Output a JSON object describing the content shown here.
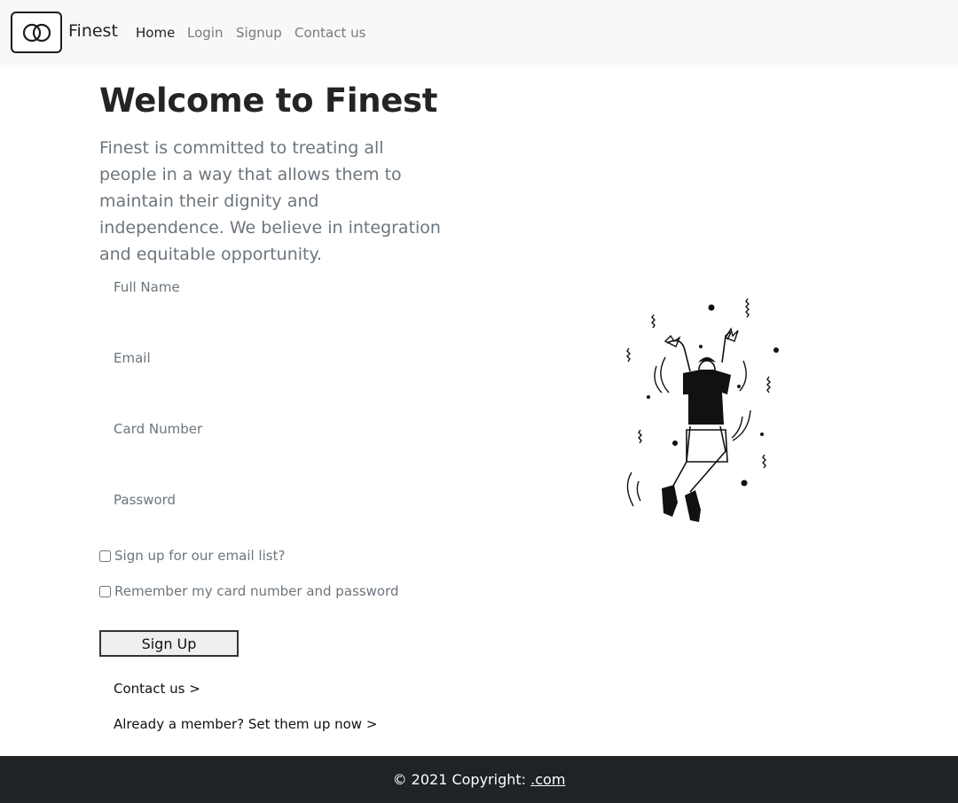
{
  "nav": {
    "brand": "Finest",
    "links": [
      {
        "label": "Home",
        "active": true
      },
      {
        "label": "Login",
        "active": false
      },
      {
        "label": "Signup",
        "active": false
      },
      {
        "label": "Contact us",
        "active": false
      }
    ]
  },
  "hero": {
    "title": "Welcome to Finest",
    "lead": "Finest is committed to treating all people in a way that allows them to maintain their dignity and independence. We believe in integration and equitable opportunity."
  },
  "form": {
    "full_name_placeholder": "Full Name",
    "email_placeholder": "Email",
    "card_number_placeholder": "Card Number",
    "password_placeholder": "Password",
    "email_list_label": "Sign up for our email list?",
    "email_list_checked": false,
    "remember_label": "Remember my card number and password",
    "remember_checked": false,
    "submit_label": "Sign Up"
  },
  "links": {
    "contact": "Contact us >",
    "member": "Already a member? Set them up now >"
  },
  "illustration": {
    "icon": "jumping-person-illustration"
  },
  "footer": {
    "copyright": "© 2021 Copyright:",
    "link": ".com"
  },
  "colors": {
    "navbar_bg": "#f8f8f8",
    "footer_bg": "#1f2326",
    "muted_text": "#6c757d",
    "heading_text": "#222426"
  }
}
